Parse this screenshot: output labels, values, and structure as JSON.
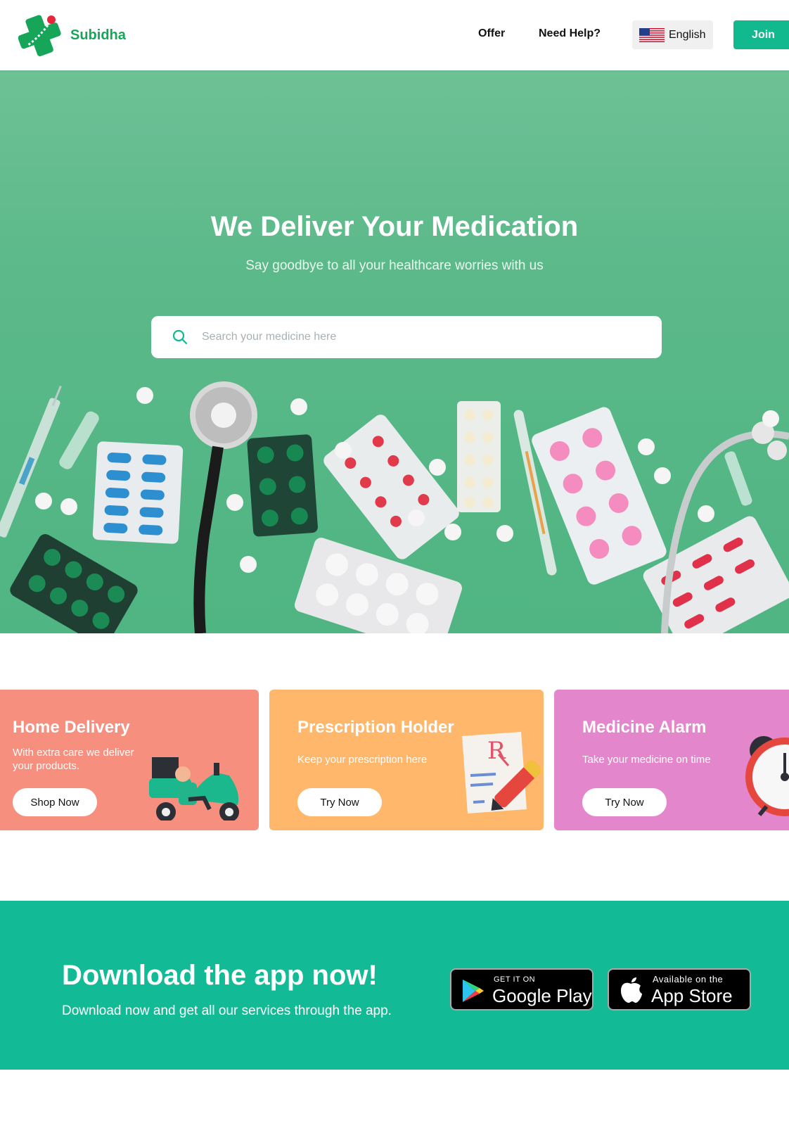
{
  "header": {
    "brand": "Subidha",
    "nav": {
      "offer": "Offer",
      "help": "Need Help?"
    },
    "language": "English",
    "join_label": "Join"
  },
  "hero": {
    "title": "We Deliver Your Medication",
    "subtitle": "Say goodbye to all your healthcare worries with us",
    "search_placeholder": "Search your medicine here"
  },
  "cards": [
    {
      "title": "Home Delivery",
      "desc": "With extra care we deliver your products.",
      "button": "Shop Now",
      "color": "#f78f7f"
    },
    {
      "title": "Prescription Holder",
      "desc": "Keep your prescription here",
      "button": "Try Now",
      "color": "#feb76b"
    },
    {
      "title": "Medicine Alarm",
      "desc": "Take your medicine on time",
      "button": "Try Now",
      "color": "#e486cb"
    }
  ],
  "download": {
    "title": "Download the app now!",
    "subtitle": "Download now and get all our services through the app.",
    "google_play": {
      "small": "GET IT ON",
      "big": "Google Play"
    },
    "app_store": {
      "small": "Available on the",
      "big": "App Store"
    }
  },
  "colors": {
    "brand": "#17a55a",
    "accent": "#12b88e",
    "hero": "#5cb98a",
    "download_bg": "#12bb95"
  },
  "icons": [
    "subidha-logo",
    "us-flag-icon",
    "search-icon",
    "scooter-delivery-illustration",
    "prescription-illustration",
    "alarm-clock-illustration",
    "google-play-icon",
    "apple-icon"
  ]
}
